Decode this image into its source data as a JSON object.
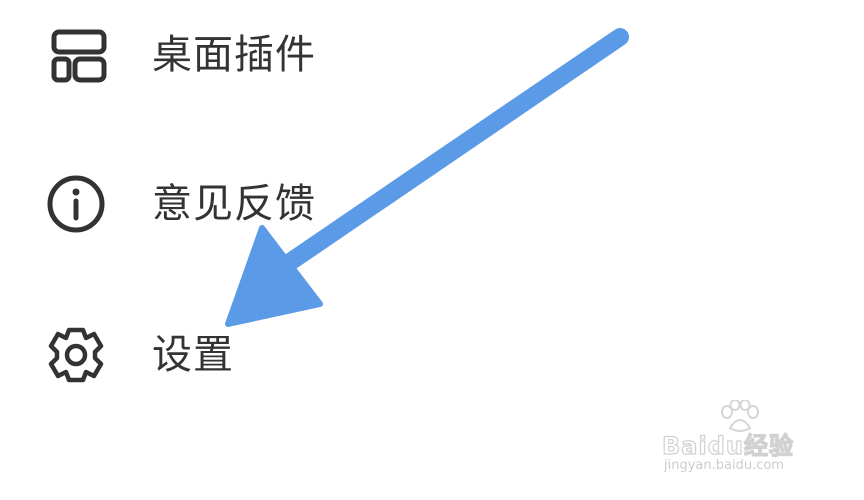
{
  "menu": {
    "items": [
      {
        "label": "桌面插件",
        "icon": "widgets-icon"
      },
      {
        "label": "意见反馈",
        "icon": "info-icon"
      },
      {
        "label": "设置",
        "icon": "gear-icon"
      }
    ]
  },
  "annotation": {
    "arrow_color": "#5b9ae6",
    "points_to": "设置"
  },
  "watermark": {
    "brand": "Baidu经验",
    "url": "jingyan.baidu.com"
  },
  "colors": {
    "text": "#333333",
    "icon_stroke": "#333333",
    "background": "#ffffff"
  }
}
